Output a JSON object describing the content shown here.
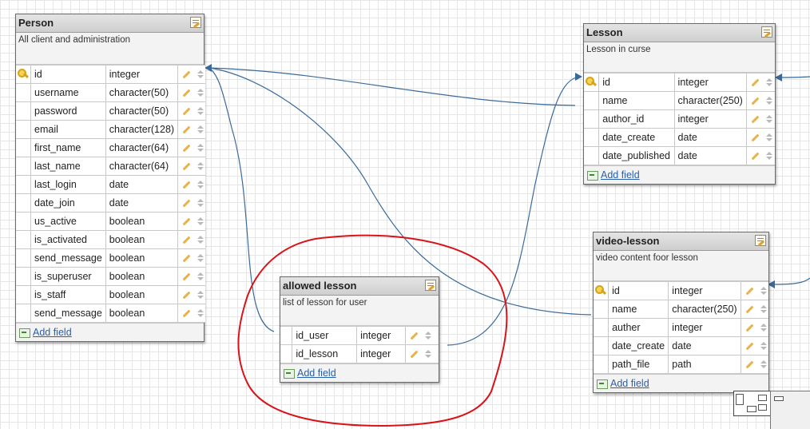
{
  "tables": [
    {
      "id": "person",
      "title": "Person",
      "description": "All client and administration",
      "add_field": "Add field",
      "fields": [
        {
          "name": "id",
          "type": "integer",
          "key": true
        },
        {
          "name": "username",
          "type": "character(50)",
          "key": false
        },
        {
          "name": "password",
          "type": "character(50)",
          "key": false
        },
        {
          "name": "email",
          "type": "character(128)",
          "key": false
        },
        {
          "name": "first_name",
          "type": "character(64)",
          "key": false
        },
        {
          "name": "last_name",
          "type": "character(64)",
          "key": false
        },
        {
          "name": "last_login",
          "type": "date",
          "key": false
        },
        {
          "name": "date_join",
          "type": "date",
          "key": false
        },
        {
          "name": "us_active",
          "type": "boolean",
          "key": false
        },
        {
          "name": "is_activated",
          "type": "boolean",
          "key": false
        },
        {
          "name": "send_message",
          "type": "boolean",
          "key": false
        },
        {
          "name": "is_superuser",
          "type": "boolean",
          "key": false
        },
        {
          "name": "is_staff",
          "type": "boolean",
          "key": false
        },
        {
          "name": "send_message",
          "type": "boolean",
          "key": false
        }
      ]
    },
    {
      "id": "lesson",
      "title": "Lesson",
      "description": "Lesson in curse",
      "add_field": "Add field",
      "fields": [
        {
          "name": "id",
          "type": "integer",
          "key": true
        },
        {
          "name": "name",
          "type": "character(250)",
          "key": false
        },
        {
          "name": "author_id",
          "type": "integer",
          "key": false
        },
        {
          "name": "date_create",
          "type": "date",
          "key": false
        },
        {
          "name": "date_published",
          "type": "date",
          "key": false
        }
      ]
    },
    {
      "id": "video",
      "title": "video-lesson",
      "description": "video content foor lesson",
      "add_field": "Add field",
      "fields": [
        {
          "name": "id",
          "type": "integer",
          "key": true
        },
        {
          "name": "name",
          "type": "character(250)",
          "key": false
        },
        {
          "name": "auther",
          "type": "integer",
          "key": false
        },
        {
          "name": "date_create",
          "type": "date",
          "key": false
        },
        {
          "name": "path_file",
          "type": "path",
          "key": false
        }
      ]
    },
    {
      "id": "allowed",
      "title": "allowed lesson",
      "description": "list of lesson for user",
      "add_field": "Add field",
      "fields": [
        {
          "name": "id_user",
          "type": "integer",
          "key": false
        },
        {
          "name": "id_lesson",
          "type": "integer",
          "key": false
        }
      ]
    }
  ],
  "colors": {
    "link": "#3a6a9a",
    "highlight": "#d8131a",
    "header": "#d6d6d6"
  }
}
